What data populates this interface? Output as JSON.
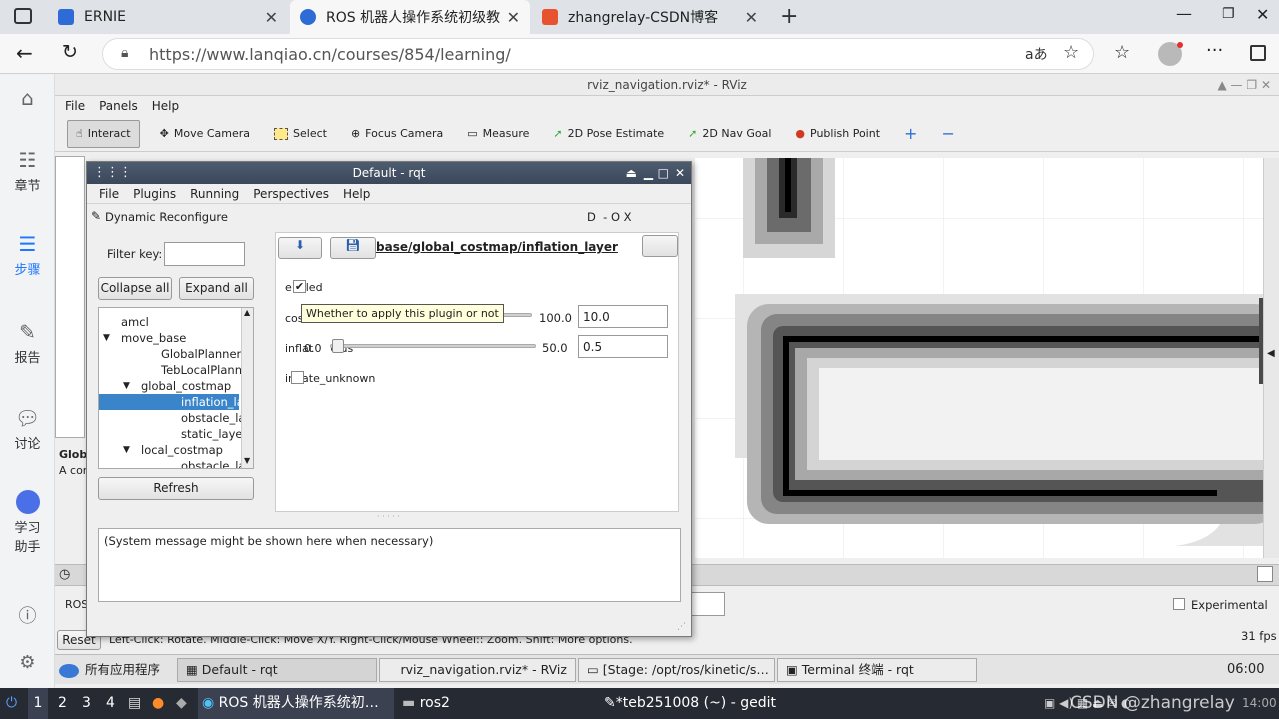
{
  "browser": {
    "tabs": [
      {
        "label": "ERNIE",
        "favicon_color": "#2e6bd6"
      },
      {
        "label": "ROS 机器人操作系统初级教",
        "favicon_color": "#2e6bd6"
      },
      {
        "label": "zhangrelay-CSDN博客",
        "favicon_color": "#e8532f"
      }
    ],
    "url": "https://www.lanqiao.cn/courses/854/learning/"
  },
  "sidebar": {
    "items": [
      {
        "label": "章节"
      },
      {
        "label": "步骤"
      },
      {
        "label": "报告"
      },
      {
        "label": "讨论"
      },
      {
        "label": "学习"
      },
      {
        "label": "助手"
      }
    ]
  },
  "rviz": {
    "title": "rviz_navigation.rviz* - RViz",
    "menu": [
      "File",
      "Panels",
      "Help"
    ],
    "tools": [
      "Interact",
      "Move Camera",
      "Select",
      "Focus Camera",
      "Measure",
      "2D Pose Estimate",
      "2D Nav Goal",
      "Publish Point"
    ],
    "fps": "31 fps",
    "experimental": "Experimental",
    "reset": "Reset",
    "status_hint": "Left-Click: Rotate.  Middle-Click: Move X/Y.  Right-Click/Mouse Wheel:: Zoom.  Shift: More options.",
    "left_labels": {
      "global": "Globa",
      "a_cor": "A cor",
      "ros": "ROS"
    }
  },
  "rqt": {
    "title": "Default - rqt",
    "menu": [
      "File",
      "Plugins",
      "Running",
      "Perspectives",
      "Help"
    ],
    "plugin_title": "Dynamic Reconfigure",
    "plugin_controls": "D  - O X",
    "filter_label": "Filter key:",
    "collapse_all": "Collapse all",
    "expand_all": "Expand all",
    "refresh": "Refresh",
    "tree": [
      {
        "label": "amcl",
        "indent": 0,
        "arrow": "",
        "selected": false
      },
      {
        "label": "move_base",
        "indent": 0,
        "arrow": "▼",
        "selected": false
      },
      {
        "label": "GlobalPlanner",
        "indent": 2,
        "arrow": "",
        "selected": false
      },
      {
        "label": "TebLocalPlanne…",
        "indent": 2,
        "arrow": "",
        "selected": false
      },
      {
        "label": "global_costmap",
        "indent": 1,
        "arrow": "▼",
        "selected": false
      },
      {
        "label": "inflation_layer",
        "indent": 3,
        "arrow": "",
        "selected": true
      },
      {
        "label": "obstacle_la…",
        "indent": 3,
        "arrow": "",
        "selected": false
      },
      {
        "label": "static_layer",
        "indent": 3,
        "arrow": "",
        "selected": false
      },
      {
        "label": "local_costmap",
        "indent": 1,
        "arrow": "▼",
        "selected": false
      },
      {
        "label": "obstacle_la…",
        "indent": 3,
        "arrow": "",
        "selected": false
      }
    ],
    "param_path": "base/global_costmap/inflation_layer",
    "params": {
      "enabled_label": "e  bled",
      "enabled_checked": true,
      "cost_label": "cos",
      "cost_max": "100.0",
      "cost_value": "10.0",
      "radius_label": "inflat     dius",
      "radius_min": "0.0",
      "radius_max": "50.0",
      "radius_value": "0.5",
      "radius_fraction": 0.01,
      "unknown_label": "in  ate_unknown"
    },
    "tooltip": "Whether to apply this plugin or not",
    "system_message": "(System message might be shown here when necessary)"
  },
  "taskbar": {
    "apps_label": "所有应用程序",
    "tasks": [
      "Default - rqt",
      "rviz_navigation.rviz* - RViz",
      "[Stage: /opt/ros/kinetic/s…",
      "Terminal 终端 - rqt"
    ],
    "clock": "06:00"
  },
  "os_taskbar": {
    "workspaces": [
      "1",
      "2",
      "3",
      "4"
    ],
    "items": [
      "ROS 机器人操作系统初…",
      "ros2",
      "*teb251008 (~) - gedit"
    ],
    "watermark": "CSDN @zhangrelay",
    "time": "14:00"
  }
}
